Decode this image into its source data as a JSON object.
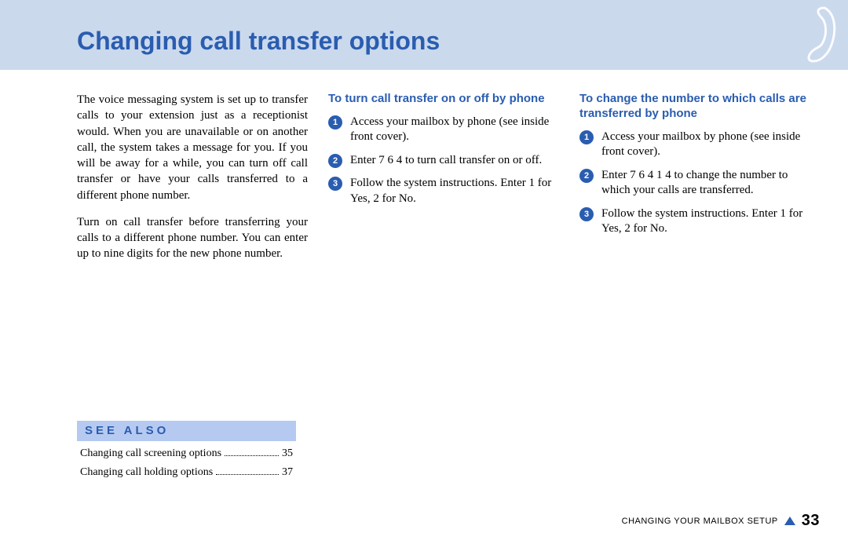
{
  "title": "Changing call transfer options",
  "intro": {
    "p1": "The voice messaging system is set up to transfer calls to your extension just as a receptionist would. When you are unavailable or on another call, the sys­tem takes a message for you. If you will be away for a while, you can turn off call transfer or have your calls transferred to a different phone number.",
    "p2": "Turn on call transfer before transferring your calls to a different phone number. You can enter up to nine digits for the new phone number."
  },
  "proc1": {
    "heading": "To turn call transfer on or off by phone",
    "steps": [
      "Access your mailbox by phone (see inside front cover).",
      "Enter 7 6 4 to turn call transfer on or off.",
      "Follow the system instructions. Enter 1 for Yes, 2 for No."
    ]
  },
  "proc2": {
    "heading": "To change the number to which calls are transferred by phone",
    "steps": [
      "Access your mailbox by phone (see inside front cover).",
      "Enter 7 6 4 1 4 to change the number to which your calls are transferred.",
      "Follow the system instructions. Enter 1 for Yes, 2 for No."
    ]
  },
  "see_also": {
    "heading": "See Also",
    "items": [
      {
        "label": "Changing call screening options",
        "page": "35"
      },
      {
        "label": "Changing call holding options",
        "page": "37"
      }
    ]
  },
  "footer": {
    "section": "Changing your mailbox setup",
    "page": "33"
  }
}
